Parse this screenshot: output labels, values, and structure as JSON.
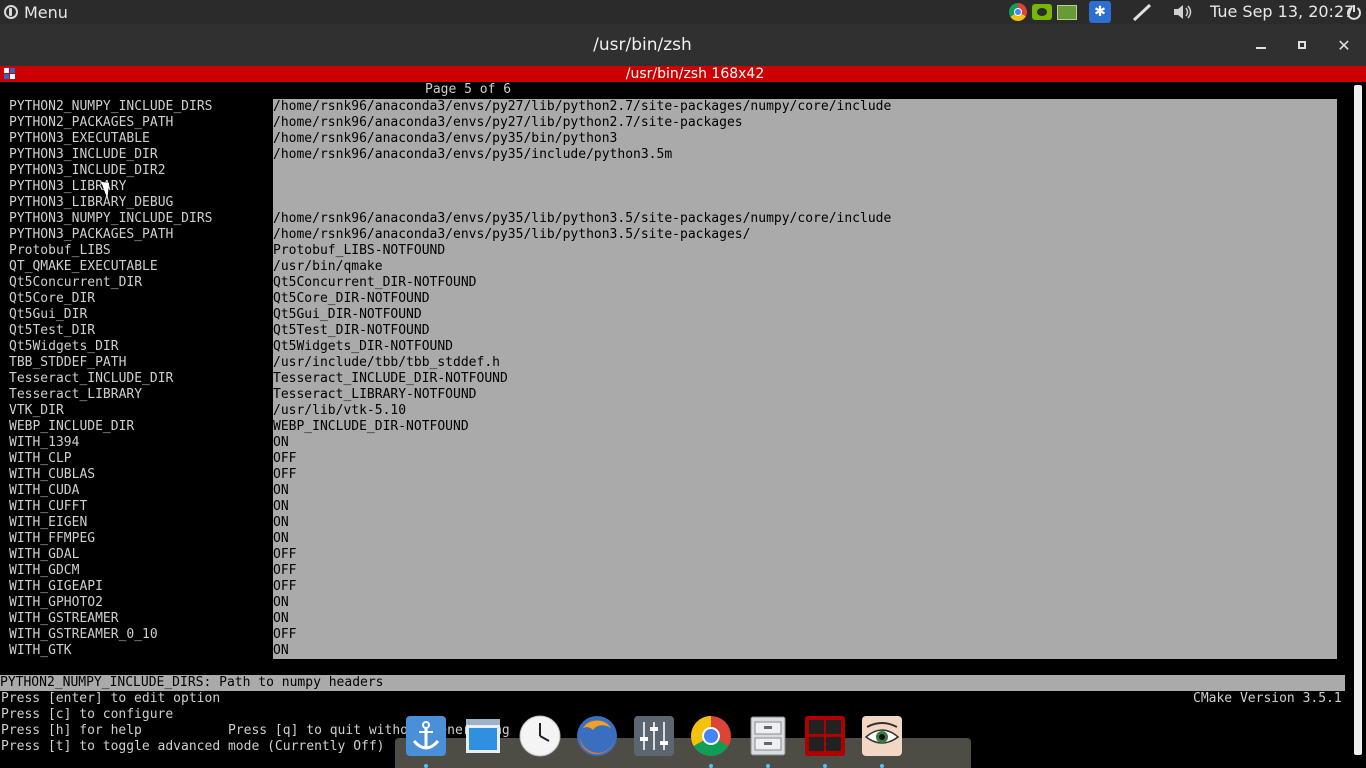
{
  "panel": {
    "menu_label": "Menu",
    "clock": "Tue Sep 13, 20:27",
    "tray_icons": [
      "chrome-icon",
      "nvidia-icon",
      "network-icon",
      "bluetooth-icon",
      "pen-icon",
      "volume-icon",
      "power-icon"
    ]
  },
  "window": {
    "title": "/usr/bin/zsh",
    "minimize_symbol": "",
    "close_symbol": "✕"
  },
  "terminal": {
    "header_title": "/usr/bin/zsh 168x42",
    "page_indicator": "Page 5 of 6",
    "entries": [
      {
        "key": "PYTHON2_NUMPY_INCLUDE_DIRS",
        "value": "/home/rsnk96/anaconda3/envs/py27/lib/python2.7/site-packages/numpy/core/include"
      },
      {
        "key": "PYTHON2_PACKAGES_PATH",
        "value": "/home/rsnk96/anaconda3/envs/py27/lib/python2.7/site-packages"
      },
      {
        "key": "PYTHON3_EXECUTABLE",
        "value": "/home/rsnk96/anaconda3/envs/py35/bin/python3"
      },
      {
        "key": "PYTHON3_INCLUDE_DIR",
        "value": "/home/rsnk96/anaconda3/envs/py35/include/python3.5m"
      },
      {
        "key": "PYTHON3_INCLUDE_DIR2",
        "value": ""
      },
      {
        "key": "PYTHON3_LIBRARY",
        "value": ""
      },
      {
        "key": "PYTHON3_LIBRARY_DEBUG",
        "value": ""
      },
      {
        "key": "PYTHON3_NUMPY_INCLUDE_DIRS",
        "value": "/home/rsnk96/anaconda3/envs/py35/lib/python3.5/site-packages/numpy/core/include"
      },
      {
        "key": "PYTHON3_PACKAGES_PATH",
        "value": "/home/rsnk96/anaconda3/envs/py35/lib/python3.5/site-packages/"
      },
      {
        "key": "Protobuf_LIBS",
        "value": "Protobuf_LIBS-NOTFOUND"
      },
      {
        "key": "QT_QMAKE_EXECUTABLE",
        "value": "/usr/bin/qmake"
      },
      {
        "key": "Qt5Concurrent_DIR",
        "value": "Qt5Concurrent_DIR-NOTFOUND"
      },
      {
        "key": "Qt5Core_DIR",
        "value": "Qt5Core_DIR-NOTFOUND"
      },
      {
        "key": "Qt5Gui_DIR",
        "value": "Qt5Gui_DIR-NOTFOUND"
      },
      {
        "key": "Qt5Test_DIR",
        "value": "Qt5Test_DIR-NOTFOUND"
      },
      {
        "key": "Qt5Widgets_DIR",
        "value": "Qt5Widgets_DIR-NOTFOUND"
      },
      {
        "key": "TBB_STDDEF_PATH",
        "value": "/usr/include/tbb/tbb_stddef.h"
      },
      {
        "key": "Tesseract_INCLUDE_DIR",
        "value": "Tesseract_INCLUDE_DIR-NOTFOUND"
      },
      {
        "key": "Tesseract_LIBRARY",
        "value": "Tesseract_LIBRARY-NOTFOUND"
      },
      {
        "key": "VTK_DIR",
        "value": "/usr/lib/vtk-5.10"
      },
      {
        "key": "WEBP_INCLUDE_DIR",
        "value": "WEBP_INCLUDE_DIR-NOTFOUND"
      },
      {
        "key": "WITH_1394",
        "value": "ON"
      },
      {
        "key": "WITH_CLP",
        "value": "OFF"
      },
      {
        "key": "WITH_CUBLAS",
        "value": "OFF"
      },
      {
        "key": "WITH_CUDA",
        "value": "ON"
      },
      {
        "key": "WITH_CUFFT",
        "value": "ON"
      },
      {
        "key": "WITH_EIGEN",
        "value": "ON"
      },
      {
        "key": "WITH_FFMPEG",
        "value": "ON"
      },
      {
        "key": "WITH_GDAL",
        "value": "OFF"
      },
      {
        "key": "WITH_GDCM",
        "value": "OFF"
      },
      {
        "key": "WITH_GIGEAPI",
        "value": "OFF"
      },
      {
        "key": "WITH_GPHOTO2",
        "value": "ON"
      },
      {
        "key": "WITH_GSTREAMER",
        "value": "ON"
      },
      {
        "key": "WITH_GSTREAMER_0_10",
        "value": "OFF"
      },
      {
        "key": "WITH_GTK",
        "value": "ON"
      }
    ],
    "help_text": "PYTHON2_NUMPY_INCLUDE_DIRS: Path to numpy headers",
    "footer": [
      "Press [enter] to edit option",
      "Press [c] to configure",
      "Press [h] for help           Press [q] to quit without generating",
      "Press [t] to toggle advanced mode (Currently Off)"
    ],
    "cmake_version": "CMake Version 3.5.1"
  },
  "dock": {
    "items": [
      "anchor-icon",
      "files-window-icon",
      "clock-app-icon",
      "firefox-icon",
      "mixer-icon",
      "chrome-icon",
      "file-cabinet-icon",
      "terminal-app-icon",
      "eye-app-icon"
    ]
  },
  "colors": {
    "terminal_header": "#cc0000",
    "value_panel": "#aaaaaa",
    "panel_bg": "#2b2b2b",
    "title_bg": "#303030"
  }
}
